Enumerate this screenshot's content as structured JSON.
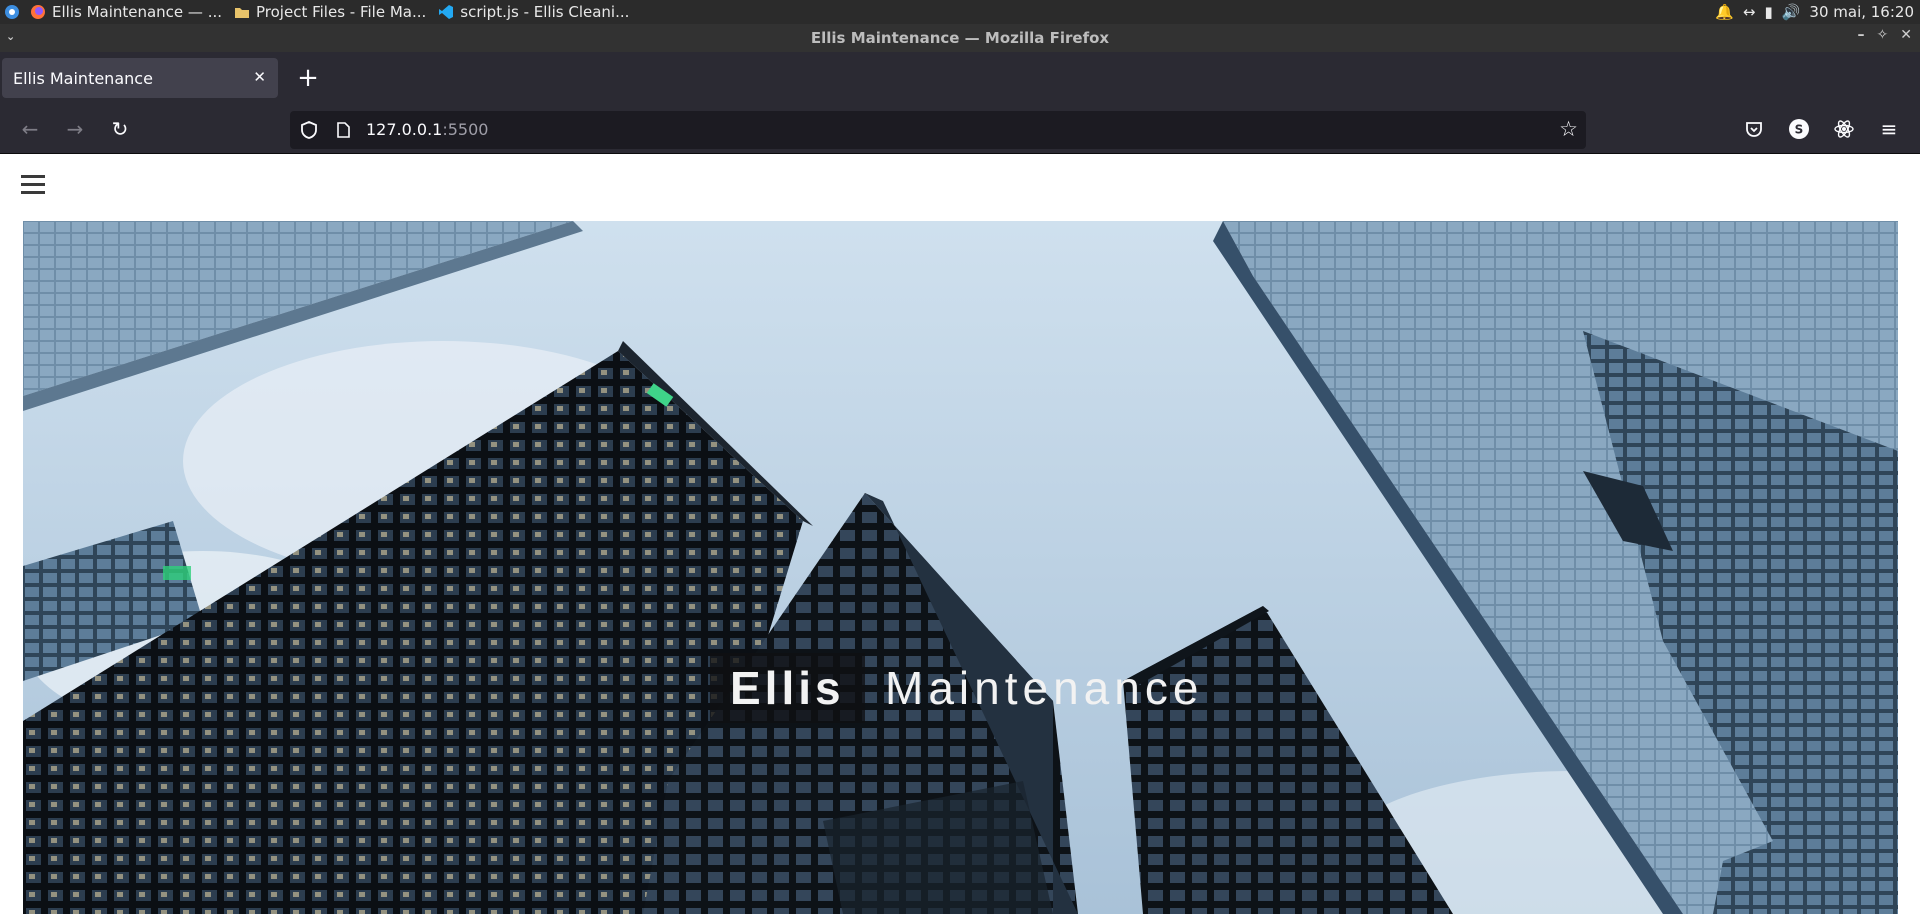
{
  "taskbar": {
    "tasks": [
      {
        "label": "Ellis Maintenance — ...",
        "icon": "firefox-icon"
      },
      {
        "label": "Project Files - File Ma...",
        "icon": "folder-icon"
      },
      {
        "label": "script.js - Ellis Cleani...",
        "icon": "vscode-icon"
      }
    ],
    "clock": "30 mai, 16:20"
  },
  "window": {
    "title": "Ellis Maintenance — Mozilla Firefox"
  },
  "browser": {
    "tab_title": "Ellis Maintenance",
    "url_host": "127.0.0.1",
    "url_port": ":5500"
  },
  "hero": {
    "title_highlight": "Ellis",
    "title_rest": "Maintenance"
  },
  "colors": {
    "chrome_bg": "#2b2a33",
    "tab_active": "#42414d",
    "urlbar_bg": "#1c1b22",
    "sky": "#b8cfe3"
  }
}
